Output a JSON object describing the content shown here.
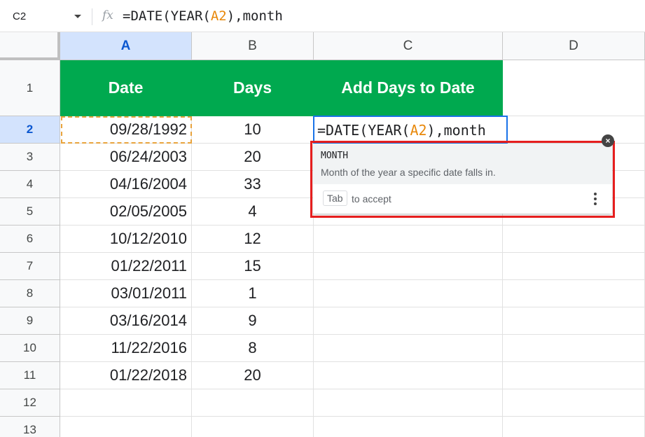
{
  "formula_bar": {
    "cell_ref": "C2",
    "fx": "fx",
    "formula_prefix": "=DATE(YEAR(",
    "formula_ref": "A2",
    "formula_suffix": "),month"
  },
  "columns": [
    "A",
    "B",
    "C",
    "D"
  ],
  "rows": [
    "1",
    "2",
    "3",
    "4",
    "5",
    "6",
    "7",
    "8",
    "9",
    "10",
    "11",
    "12",
    "13"
  ],
  "table": {
    "headers": [
      "Date",
      "Days",
      "Add Days to Date"
    ],
    "dates": [
      "09/28/1992",
      "06/24/2003",
      "04/16/2004",
      "02/05/2005",
      "10/12/2010",
      "01/22/2011",
      "03/01/2011",
      "03/16/2014",
      "11/22/2016",
      "01/22/2018"
    ],
    "days": [
      "10",
      "20",
      "33",
      "4",
      "12",
      "15",
      "1",
      "9",
      "8",
      "20"
    ]
  },
  "editor": {
    "prefix": "=DATE(YEAR(",
    "ref": "A2",
    "suffix": "),month"
  },
  "autocomplete": {
    "function_name": "MONTH",
    "description": "Month of the year a specific date falls in.",
    "key": "Tab",
    "accept_text": "to accept",
    "close_symbol": "×",
    "more_icon": "more-vert-icon"
  },
  "colors": {
    "header_green": "#00a94f",
    "selection_blue": "#1a73e8",
    "highlight_red": "#e61e1e",
    "ref_orange": "#e8880a"
  }
}
